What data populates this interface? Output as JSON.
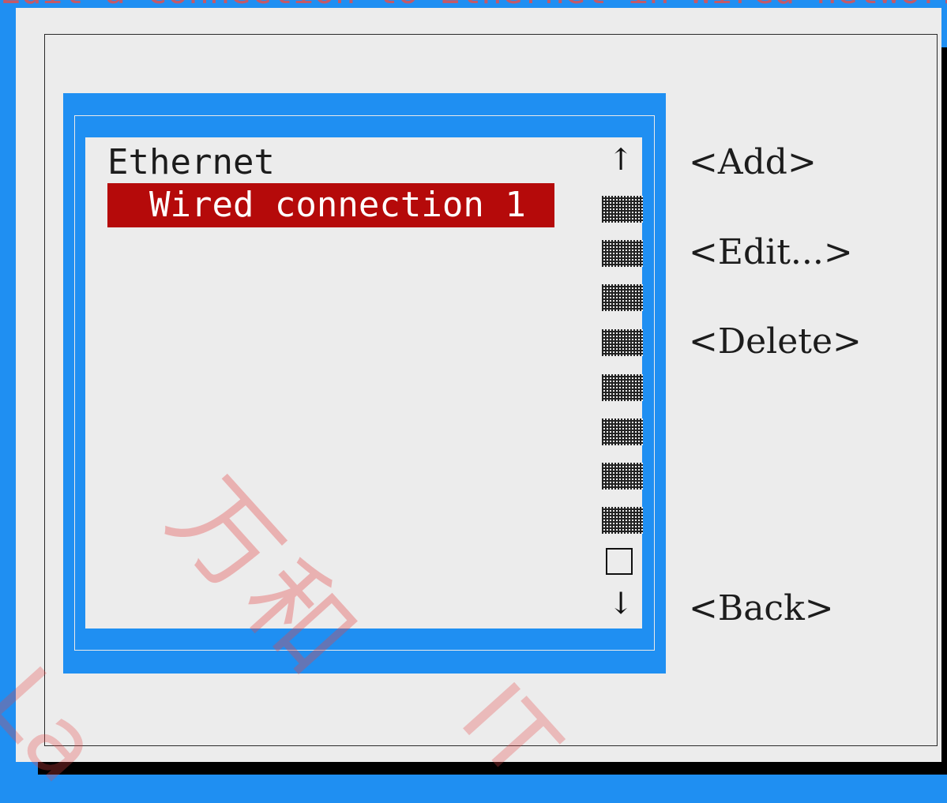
{
  "banner": {
    "text": "Edit a connection to Ethernet in Wired network settings"
  },
  "connection_list": {
    "category": "Ethernet",
    "items": [
      {
        "label": "  Wired connection 1",
        "selected": true
      }
    ],
    "scroll_up_glyph": "↑",
    "scroll_down_glyph": "↓"
  },
  "actions": {
    "add_label": "<Add>",
    "edit_label": "<Edit...>",
    "delete_label": "<Delete>",
    "back_label": "<Back>"
  },
  "watermark": {
    "chinese": "万和",
    "latin_left": "La",
    "latin_right": "IT"
  },
  "colors": {
    "dialog_background": "#ececec",
    "border_blue": "#1f8ff2",
    "selection_red": "#b50a0a",
    "selection_text": "#ffffff",
    "watermark_red": "#e64646"
  }
}
